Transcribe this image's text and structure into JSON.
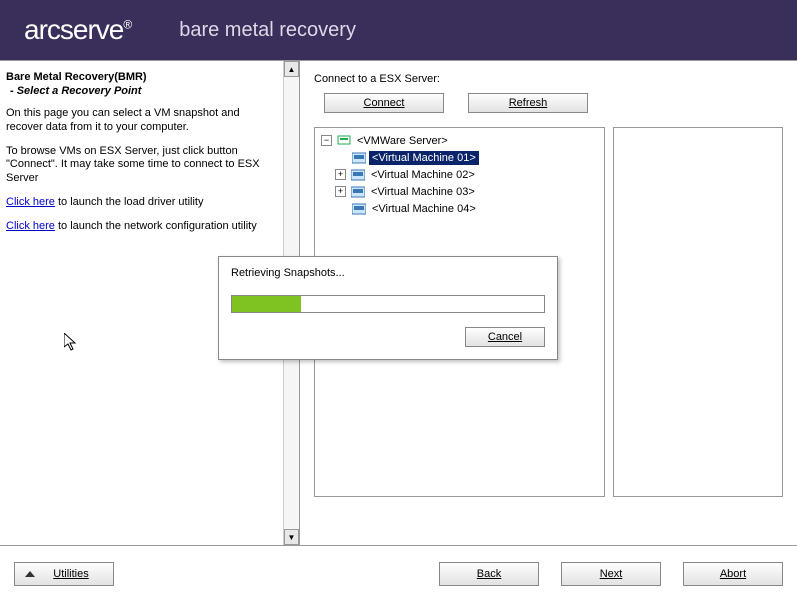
{
  "header": {
    "logo": "arcserve",
    "reg": "®",
    "product": "bare metal recovery"
  },
  "sidebar": {
    "title": "Bare Metal Recovery(BMR)",
    "subtitle": "- Select a Recovery Point",
    "p1": "On this page you can select a VM snapshot and recover data from it to your computer.",
    "p2": "To browse VMs on ESX Server, just click button \"Connect\". It may take some time to connect to ESX Server",
    "link1_text": "Click here",
    "link1_rest": " to launch the load driver utility",
    "link2_text": "Click here",
    "link2_rest": " to launch the network configuration utility"
  },
  "main": {
    "connect_label": "Connect to a ESX Server:",
    "connect_btn": "Connect",
    "refresh_btn": "Refresh",
    "tree": {
      "server": "<VMWare Server>",
      "vms": [
        "<Virtual Machine 01>",
        "<Virtual Machine 02>",
        "<Virtual Machine 03>",
        "<Virtual Machine 04>"
      ]
    }
  },
  "dialog": {
    "title": "Retrieving Snapshots...",
    "cancel": "Cancel",
    "progress_pct": 22
  },
  "footer": {
    "utilities": "Utilities",
    "back": "Back",
    "next": "Next",
    "abort": "Abort"
  }
}
